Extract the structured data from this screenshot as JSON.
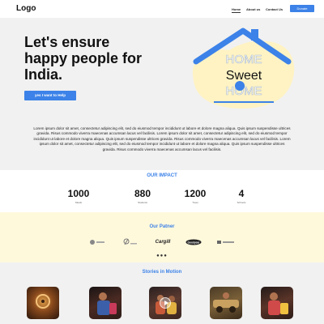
{
  "header": {
    "logo": "Logo",
    "nav": [
      "Home",
      "About us",
      "Contact Us"
    ],
    "donate_label": "Donate"
  },
  "hero": {
    "headline": "Let's ensure happy people for India.",
    "cta_label": "yes I want to Help",
    "illustration_text": [
      "HOME",
      "Sweet",
      "HOME"
    ],
    "body": "Lorem ipsum dolor sit amet, consectetur adipiscing elit, sed do eiusmod tempor incididunt ut labore et dolore magna aliqua. Quis ipsum suspendisse ultrices gravida. Risus commodo viverra maecenas accumsan lacus vel facilisis. Lorem ipsum dolor sit amet, consectetur adipiscing elit, sed do eiusmod tempor incididunt ut labore et dolore magna aliqua. Quis ipsum suspendisse ultrices gravida. Risus commodo viverra maecenas accumsan lacus vel facilisis. Lorem ipsum dolor sit amet, consectetur adipiscing elit, sed do eiusmod tempor incididunt ut labore et dolore magna aliqua. Quis ipsum suspendisse ultrices gravida. Risus commodo viverra maecenas accumsan lacus vel facilisis."
  },
  "impact": {
    "title": "OUR IMPACT",
    "stats": [
      {
        "value": "1000",
        "label": "Meals"
      },
      {
        "value": "880",
        "label": "Students"
      },
      {
        "value": "1200",
        "label": "Trees"
      },
      {
        "value": "4",
        "label": "Schools"
      }
    ]
  },
  "partners": {
    "title": "Our Patner",
    "logos": [
      "partner-1",
      "partner-2",
      "Cargill",
      "Goodyear",
      "partner-5"
    ],
    "pager": "●●●"
  },
  "stories": {
    "title": "Stories in Motion",
    "count": 5
  },
  "colors": {
    "accent": "#3c82e8",
    "hero_bg": "#f1f1f1",
    "partner_bg": "#fff9dc",
    "blob": "#fff3c4"
  }
}
